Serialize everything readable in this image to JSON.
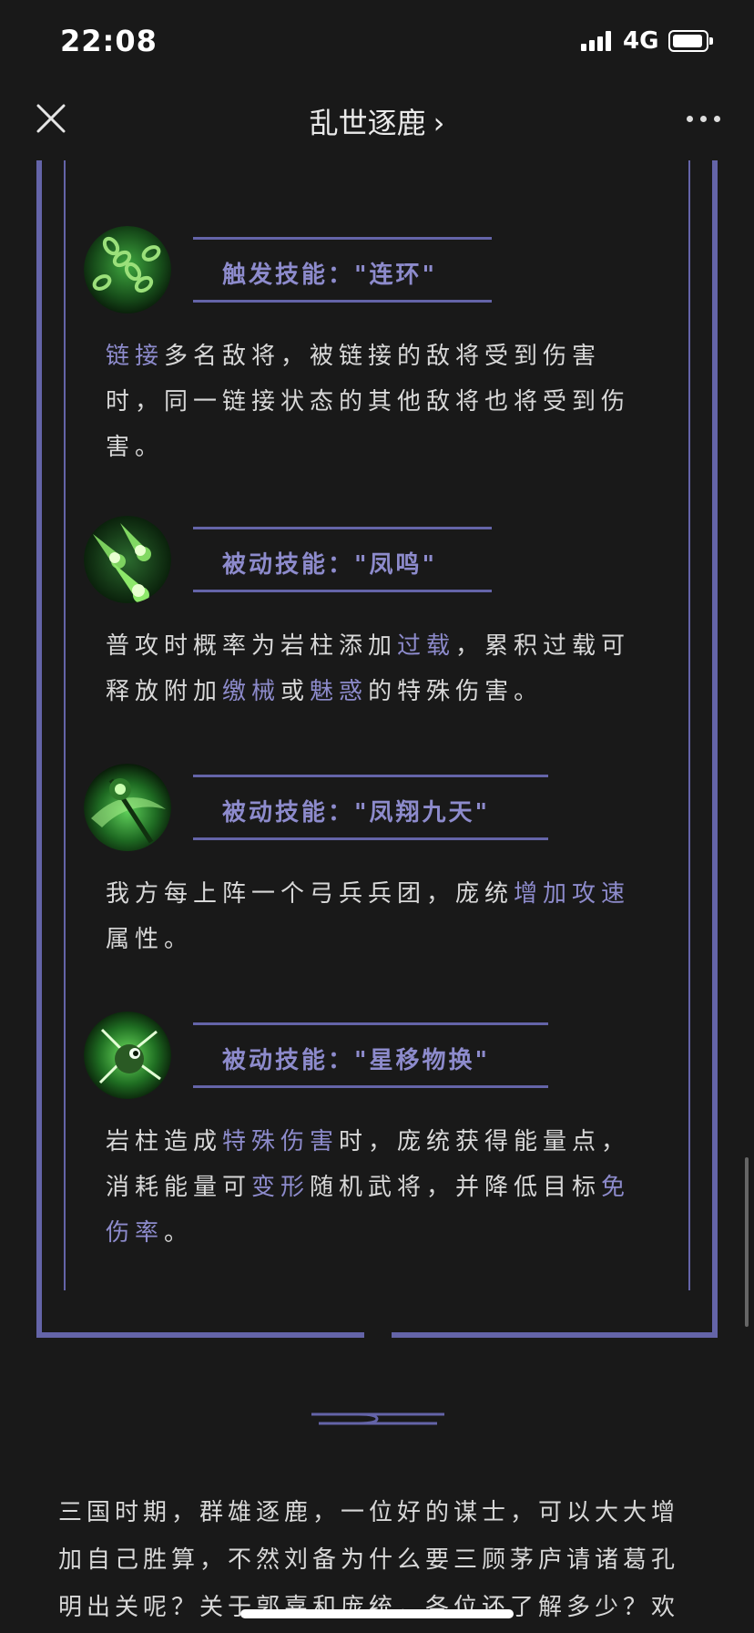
{
  "status_bar": {
    "time": "22:08",
    "network": "4G"
  },
  "nav": {
    "title": "乱世逐鹿",
    "chevron": "›"
  },
  "skills": [
    {
      "icon": "chain-orb-icon",
      "title": "触发技能：\"连环\"",
      "desc": [
        {
          "t": "链接",
          "hl": true
        },
        {
          "t": "多名敌将，被链接的敌将受到伤害时，同一链接状态的其他敌将也将受到伤害。",
          "hl": false
        }
      ]
    },
    {
      "icon": "green-comet-icon",
      "title": "被动技能：\"凤鸣\"",
      "desc": [
        {
          "t": "普攻时概率为岩柱添加",
          "hl": false
        },
        {
          "t": "过载",
          "hl": true
        },
        {
          "t": "，累积过载可释放附加",
          "hl": false
        },
        {
          "t": "缴械",
          "hl": true
        },
        {
          "t": "或",
          "hl": false
        },
        {
          "t": "魅惑",
          "hl": true
        },
        {
          "t": "的特殊伤害。",
          "hl": false
        }
      ]
    },
    {
      "icon": "soaring-phoenix-icon",
      "title": "被动技能：\"凤翔九天\"",
      "desc": [
        {
          "t": "我方每上阵一个弓兵兵团，庞统",
          "hl": false
        },
        {
          "t": "增加攻速",
          "hl": true
        },
        {
          "t": "属性。",
          "hl": false
        }
      ]
    },
    {
      "icon": "star-shift-icon",
      "title": "被动技能：\"星移物换\"",
      "desc": [
        {
          "t": "岩柱造成",
          "hl": false
        },
        {
          "t": "特殊伤害",
          "hl": true
        },
        {
          "t": "时，庞统获得能量点，消耗能量可",
          "hl": false
        },
        {
          "t": "变形",
          "hl": true
        },
        {
          "t": "随机武将，并降低目标",
          "hl": false
        },
        {
          "t": "免伤率",
          "hl": true
        },
        {
          "t": "。",
          "hl": false
        }
      ]
    }
  ],
  "article": {
    "text": "三国时期，群雄逐鹿，一位好的谋士，可以大大增加自己胜算，不然刘备为什么要三顾茅庐请诸葛孔明出关呢？关于郭嘉和庞统，各位还了解多少？欢"
  },
  "colors": {
    "accent": "#8d8bcc",
    "frame": "#6464a8",
    "background": "#191919"
  }
}
